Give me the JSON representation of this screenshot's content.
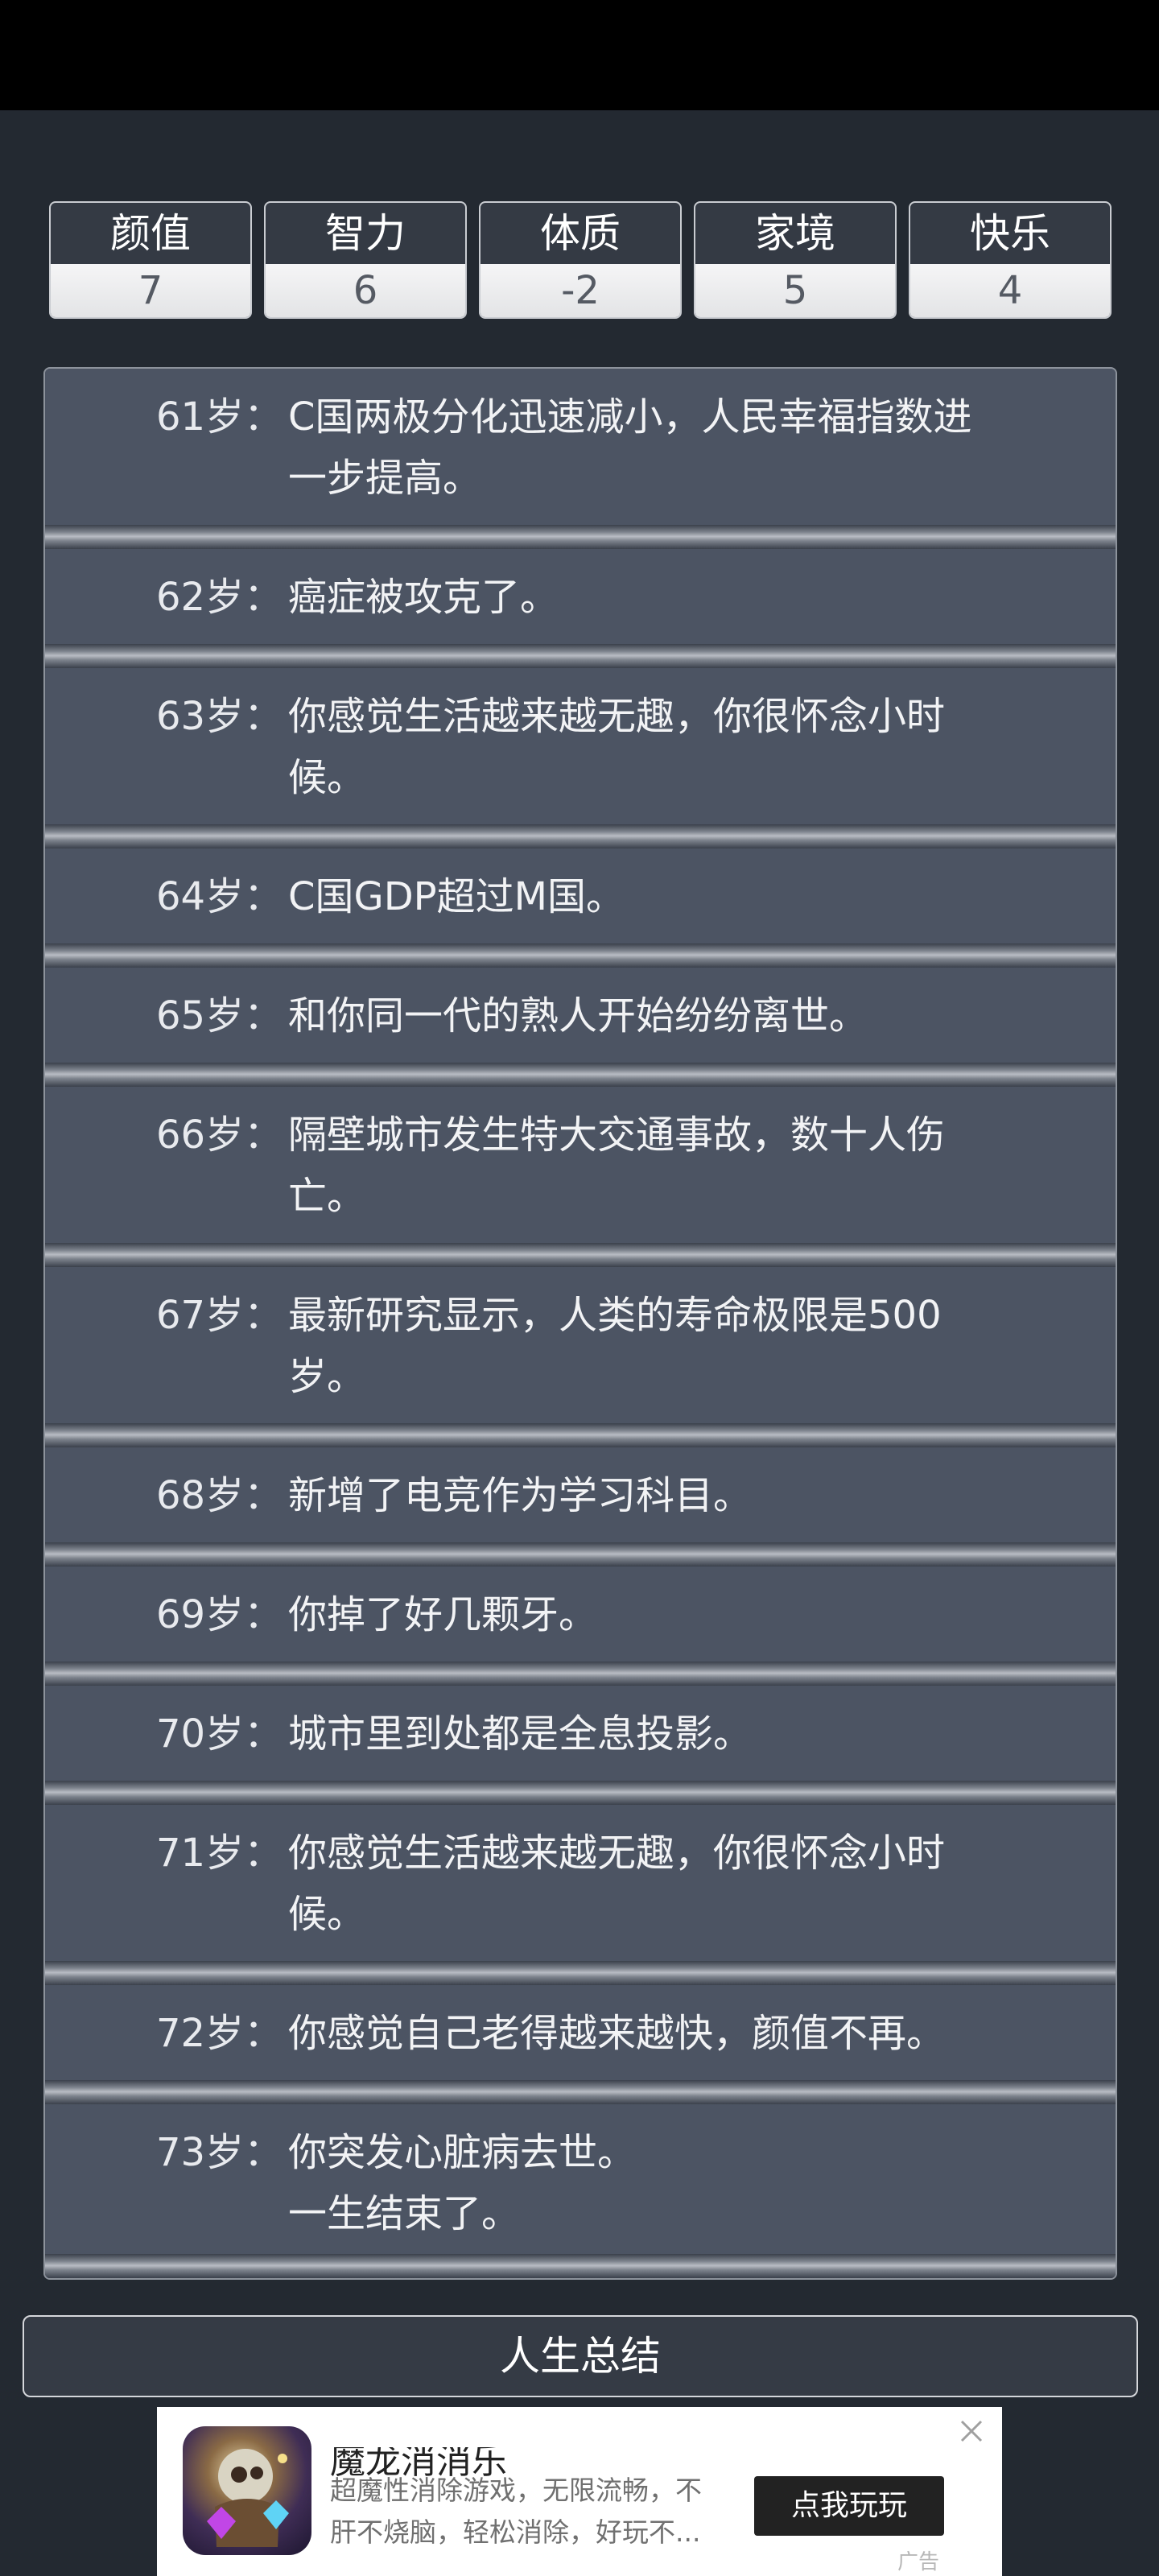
{
  "attributes": [
    {
      "label": "颜值",
      "value": "7"
    },
    {
      "label": "智力",
      "value": "6"
    },
    {
      "label": "体质",
      "value": "-2"
    },
    {
      "label": "家境",
      "value": "5"
    },
    {
      "label": "快乐",
      "value": "4"
    }
  ],
  "events": [
    {
      "age": "61岁：",
      "text": "C国两极分化迅速减小，人民幸福指数进\n一步提高。"
    },
    {
      "age": "62岁：",
      "text": "癌症被攻克了。"
    },
    {
      "age": "63岁：",
      "text": "你感觉生活越来越无趣，你很怀念小时\n候。"
    },
    {
      "age": "64岁：",
      "text": "C国GDP超过M国。"
    },
    {
      "age": "65岁：",
      "text": "和你同一代的熟人开始纷纷离世。"
    },
    {
      "age": "66岁：",
      "text": "隔壁城市发生特大交通事故，数十人伤\n亡。"
    },
    {
      "age": "67岁：",
      "text": "最新研究显示，人类的寿命极限是500\n岁。"
    },
    {
      "age": "68岁：",
      "text": "新增了电竞作为学习科目。"
    },
    {
      "age": "69岁：",
      "text": "你掉了好几颗牙。"
    },
    {
      "age": "70岁：",
      "text": "城市里到处都是全息投影。"
    },
    {
      "age": "71岁：",
      "text": "你感觉生活越来越无趣，你很怀念小时\n候。"
    },
    {
      "age": "72岁：",
      "text": "你感觉自己老得越来越快，颜值不再。"
    },
    {
      "age": "73岁：",
      "text": "你突发心脏病去世。\n一生结束了。"
    }
  ],
  "summary_button": {
    "label": "人生总结"
  },
  "ad": {
    "title": "魔龙消消乐",
    "description": "超魔性消除游戏，无限流畅，不\n肝不烧脑，轻松消除，好玩不...",
    "cta": "点我玩玩",
    "tag": "广告",
    "icon": "game-character-icon",
    "close_icon": "close-icon"
  }
}
